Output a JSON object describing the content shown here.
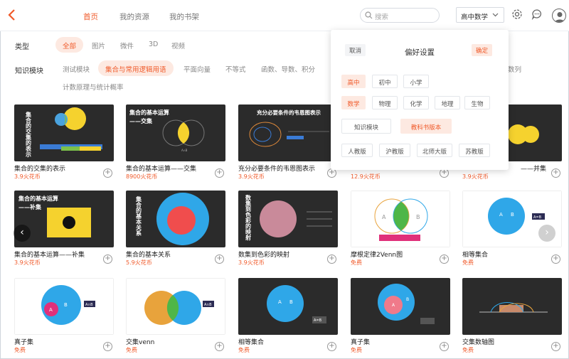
{
  "nav": {
    "tabs": [
      "首页",
      "我的资源",
      "我的书架"
    ]
  },
  "search": {
    "placeholder": "搜索"
  },
  "grade_select": {
    "value": "高中数学"
  },
  "filters": {
    "type_label": "类型",
    "type_chips": [
      "全部",
      "图片",
      "微件",
      "3D",
      "视频"
    ],
    "module_label": "知识模块",
    "module_chips": [
      "测试模块",
      "集合与常用逻辑用语",
      "平面向量",
      "不等式",
      "函数、导数、积分",
      "数列",
      "计数原理与统计概率"
    ]
  },
  "cards": [
    {
      "title": "集合的交集的表示",
      "price": "3.9火花币"
    },
    {
      "title": "集合的基本运算——交集",
      "price": "8900火花币"
    },
    {
      "title": "充分必要条件的韦恩图表示",
      "price": "3.9火花币"
    },
    {
      "title": "",
      "price": "12.9火花币"
    },
    {
      "title": "——并集",
      "price": "3.9火花币"
    },
    {
      "title": "集合的基本运算——补集",
      "price": "3.9火花币"
    },
    {
      "title": "集合的基本关系",
      "price": "5.9火花币"
    },
    {
      "title": "数集到色彩的映射",
      "price": "3.9火花币"
    },
    {
      "title": "摩根定律2Venn图",
      "price": "免费"
    },
    {
      "title": "相等集合",
      "price": "免费"
    },
    {
      "title": "真子集",
      "price": "免费"
    },
    {
      "title": "交集venn",
      "price": "免费"
    },
    {
      "title": "相等集合",
      "price": "免费"
    },
    {
      "title": "真子集",
      "price": "免费"
    },
    {
      "title": "交集数轴图",
      "price": "免费"
    }
  ],
  "thumb_text": {
    "t1": "集合的交集的表示",
    "t2_a": "集合的基本运算",
    "t2_b": "——交集",
    "t3": "充分必要条件的韦恩图表示",
    "t6_a": "集合的基本运算",
    "t6_b": "——补集",
    "t7": "集合的基本关系",
    "t8": "数集到色彩的映射",
    "A": "A",
    "B": "B",
    "AB": "A∩B",
    "AeqB": "A=B",
    "AuB": "A∪B"
  },
  "popup": {
    "cancel": "取消",
    "title": "偏好设置",
    "ok": "确定",
    "stages": [
      "高中",
      "初中",
      "小学"
    ],
    "subjects": [
      "数学",
      "物理",
      "化学",
      "地理",
      "生物"
    ],
    "views": [
      "知识模块",
      "教科书版本"
    ],
    "editions": [
      "人教版",
      "沪教版",
      "北师大版",
      "苏教版"
    ]
  },
  "colors": {
    "accent": "#f05a2a",
    "accent_bg": "#fde9e1"
  }
}
